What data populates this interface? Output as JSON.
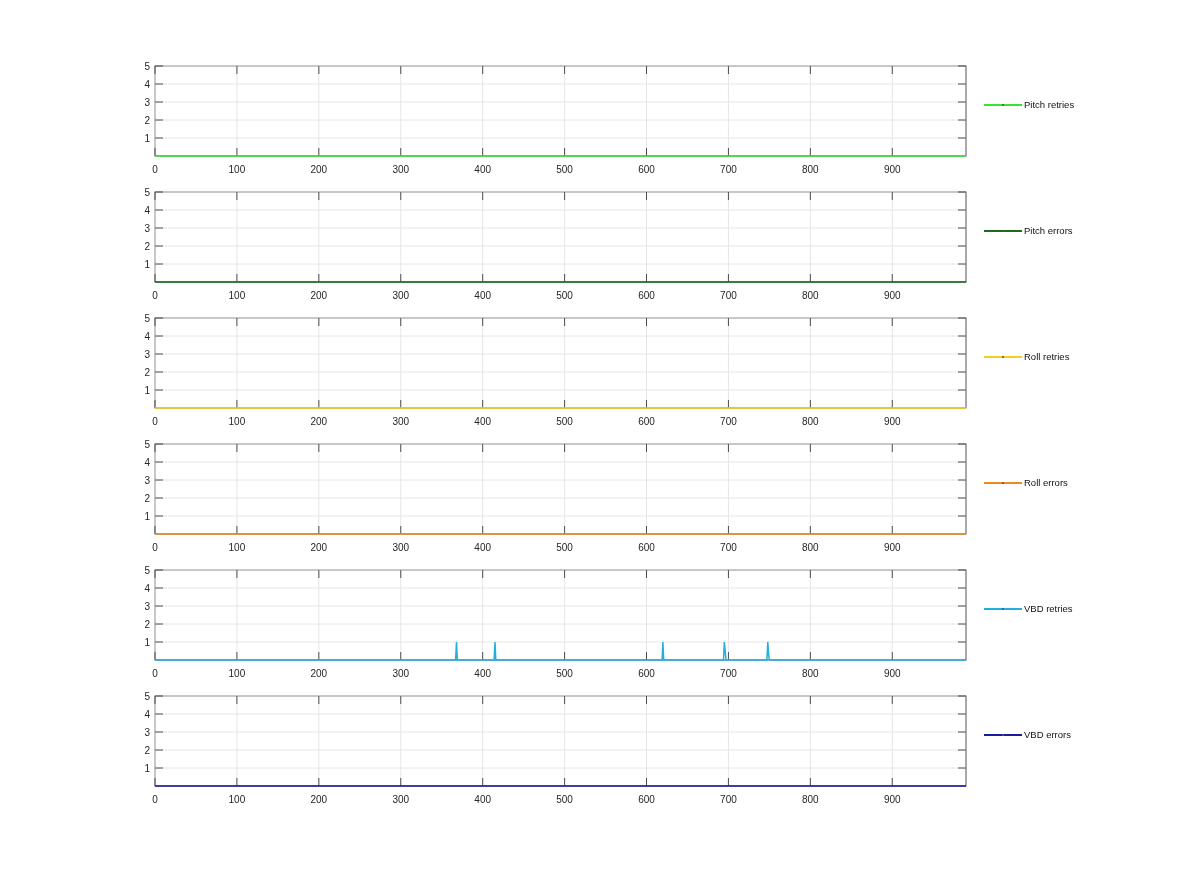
{
  "charts": [
    {
      "chart_data": {
        "type": "line",
        "grid": true,
        "xlim": [
          0,
          990
        ],
        "ylim": [
          0,
          5
        ],
        "xticks": [
          0,
          100,
          200,
          300,
          400,
          500,
          600,
          700,
          800,
          900
        ],
        "yticks": [
          1,
          2,
          3,
          4,
          5
        ],
        "x": [
          0,
          990
        ],
        "series": [
          {
            "name": "Pitch retries",
            "color": "#33e633",
            "values": [
              0,
              0
            ]
          }
        ]
      }
    },
    {
      "chart_data": {
        "type": "line",
        "grid": true,
        "xlim": [
          0,
          990
        ],
        "ylim": [
          0,
          5
        ],
        "xticks": [
          0,
          100,
          200,
          300,
          400,
          500,
          600,
          700,
          800,
          900
        ],
        "yticks": [
          1,
          2,
          3,
          4,
          5
        ],
        "x": [
          0,
          990
        ],
        "series": [
          {
            "name": "Pitch errors",
            "color": "#1a6b1a",
            "values": [
              0,
              0
            ]
          }
        ]
      }
    },
    {
      "chart_data": {
        "type": "line",
        "grid": true,
        "xlim": [
          0,
          990
        ],
        "ylim": [
          0,
          5
        ],
        "xticks": [
          0,
          100,
          200,
          300,
          400,
          500,
          600,
          700,
          800,
          900
        ],
        "yticks": [
          1,
          2,
          3,
          4,
          5
        ],
        "x": [
          0,
          990
        ],
        "series": [
          {
            "name": "Roll retries",
            "color": "#f0d020",
            "values": [
              0,
              0
            ]
          }
        ]
      }
    },
    {
      "chart_data": {
        "type": "line",
        "grid": true,
        "xlim": [
          0,
          990
        ],
        "ylim": [
          0,
          5
        ],
        "xticks": [
          0,
          100,
          200,
          300,
          400,
          500,
          600,
          700,
          800,
          900
        ],
        "yticks": [
          1,
          2,
          3,
          4,
          5
        ],
        "x": [
          0,
          990
        ],
        "series": [
          {
            "name": "Roll errors",
            "color": "#f08a20",
            "values": [
              0,
              0
            ]
          }
        ]
      }
    },
    {
      "chart_data": {
        "type": "line",
        "grid": true,
        "xlim": [
          0,
          990
        ],
        "ylim": [
          0,
          5
        ],
        "xticks": [
          0,
          100,
          200,
          300,
          400,
          500,
          600,
          700,
          800,
          900
        ],
        "yticks": [
          1,
          2,
          3,
          4,
          5
        ],
        "x": [
          0,
          367,
          368,
          369,
          414,
          415,
          416,
          619,
          620,
          621,
          694,
          695,
          696,
          697,
          747,
          748,
          749,
          750,
          990
        ],
        "series": [
          {
            "name": "VBD retries",
            "color": "#20b0e0",
            "values": [
              0,
              0,
              1,
              0,
              0,
              1,
              0,
              0,
              1,
              0,
              0,
              1,
              0.5,
              0,
              0,
              1,
              0.3,
              0,
              0
            ]
          }
        ]
      }
    },
    {
      "chart_data": {
        "type": "line",
        "grid": true,
        "xlim": [
          0,
          990
        ],
        "ylim": [
          0,
          5
        ],
        "xticks": [
          0,
          100,
          200,
          300,
          400,
          500,
          600,
          700,
          800,
          900
        ],
        "yticks": [
          1,
          2,
          3,
          4,
          5
        ],
        "x": [
          0,
          990
        ],
        "series": [
          {
            "name": "VBD errors",
            "color": "#1a1aa0",
            "values": [
              0,
              0
            ]
          }
        ]
      }
    }
  ]
}
